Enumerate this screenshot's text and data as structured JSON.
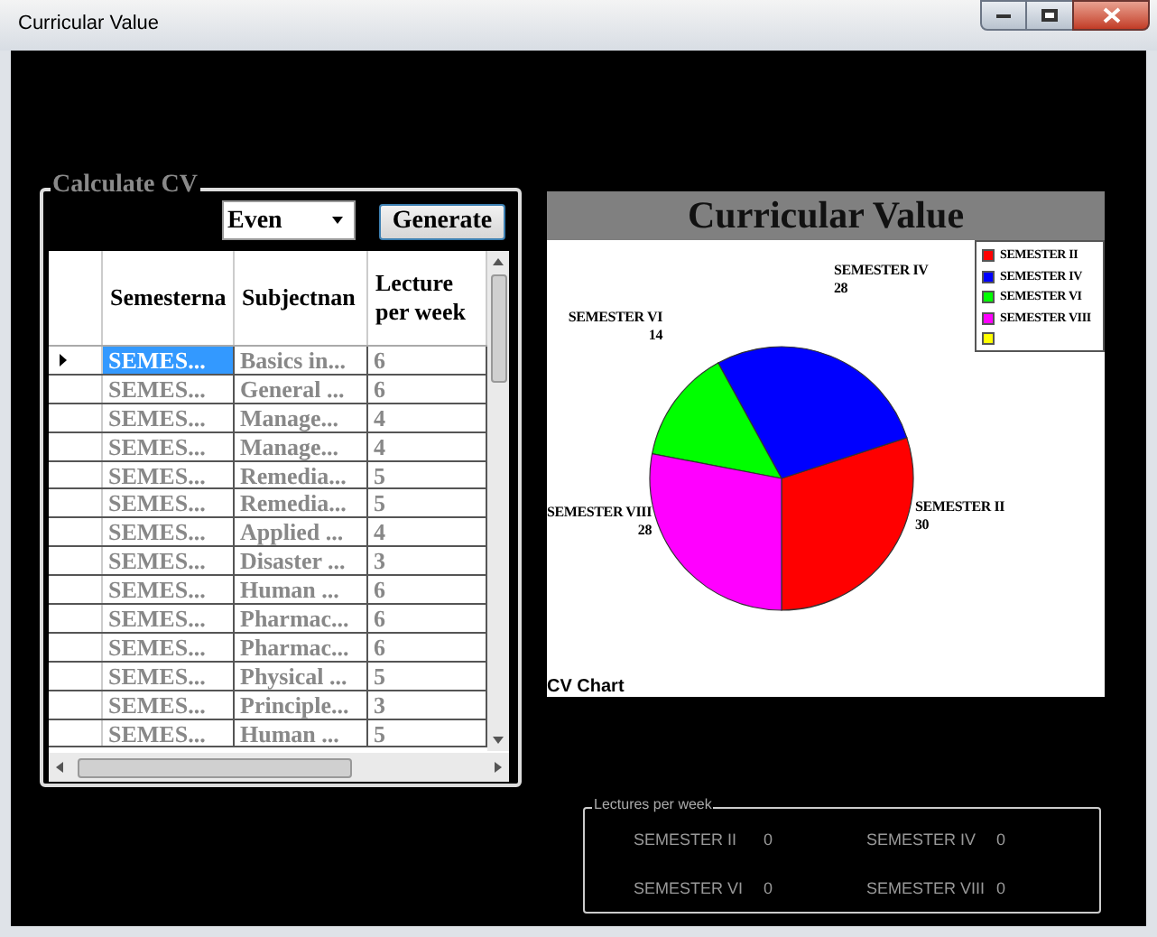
{
  "window": {
    "title": "Curricular Value"
  },
  "calculate_group": {
    "title": "Calculate CV",
    "dropdown": {
      "value": "Even"
    },
    "generate_button": "Generate",
    "table": {
      "columns": [
        "Semesterna",
        "Subjectnan",
        "Lecture per week"
      ],
      "rows": [
        {
          "selected": true,
          "cells": [
            "SEMES...",
            "Basics in...",
            "6"
          ]
        },
        {
          "selected": false,
          "cells": [
            "SEMES...",
            "General ...",
            "6"
          ]
        },
        {
          "selected": false,
          "cells": [
            "SEMES...",
            "Manage...",
            "4"
          ]
        },
        {
          "selected": false,
          "cells": [
            "SEMES...",
            "Manage...",
            "4"
          ]
        },
        {
          "selected": false,
          "cells": [
            "SEMES...",
            "Remedia...",
            "5"
          ]
        },
        {
          "selected": false,
          "cells": [
            "SEMES...",
            "Remedia...",
            "5"
          ]
        },
        {
          "selected": false,
          "cells": [
            "SEMES...",
            "Applied ...",
            "4"
          ]
        },
        {
          "selected": false,
          "cells": [
            "SEMES...",
            "Disaster ...",
            "3"
          ]
        },
        {
          "selected": false,
          "cells": [
            "SEMES...",
            "Human ...",
            "6"
          ]
        },
        {
          "selected": false,
          "cells": [
            "SEMES...",
            "Pharmac...",
            "6"
          ]
        },
        {
          "selected": false,
          "cells": [
            "SEMES...",
            "Pharmac...",
            "6"
          ]
        },
        {
          "selected": false,
          "cells": [
            "SEMES...",
            "Physical ...",
            "5"
          ]
        },
        {
          "selected": false,
          "cells": [
            "SEMES...",
            "Principle...",
            "3"
          ]
        },
        {
          "selected": false,
          "cells": [
            "SEMES...",
            "Human ...",
            "5"
          ]
        }
      ]
    }
  },
  "chart": {
    "caption": "CV Chart",
    "legend": [
      {
        "label": "SEMESTER II",
        "color": "#ff0000"
      },
      {
        "label": "SEMESTER IV",
        "color": "#0000ff"
      },
      {
        "label": "SEMESTER VI",
        "color": "#00ff00"
      },
      {
        "label": "SEMESTER VIII",
        "color": "#ff00ff"
      },
      {
        "color": "#ffff00"
      }
    ],
    "chart_data": {
      "type": "pie",
      "title": "Curricular Value",
      "categories": [
        "SEMESTER II",
        "SEMESTER IV",
        "SEMESTER VI",
        "SEMESTER VIII"
      ],
      "series": [
        {
          "colors": [
            "#ff0000",
            "#0000ff",
            "#00ff00",
            "#ff00ff"
          ],
          "values": [
            30,
            28,
            14,
            28
          ]
        }
      ],
      "data_labels": true
    }
  },
  "lectures_group": {
    "title": "Lectures per week",
    "items": [
      {
        "label": "SEMESTER II",
        "value": "0"
      },
      {
        "label": "SEMESTER IV",
        "value": "0"
      },
      {
        "label": "SEMESTER VI",
        "value": "0"
      },
      {
        "label": "SEMESTER VIII",
        "value": "0"
      }
    ]
  }
}
